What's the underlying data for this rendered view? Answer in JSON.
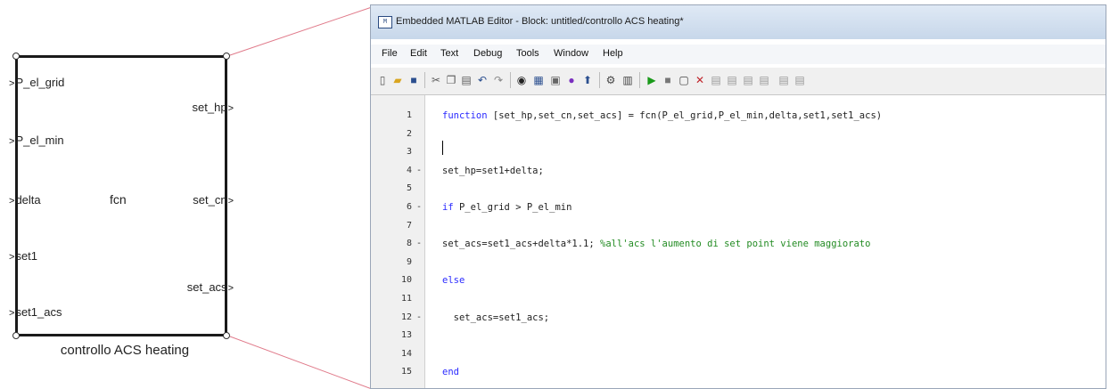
{
  "block": {
    "inputs": [
      "P_el_grid",
      "P_el_min",
      "delta",
      "set1",
      "set1_acs"
    ],
    "outputs": [
      "set_hp",
      "set_cn",
      "set_acs"
    ],
    "function_name": "fcn",
    "caption": "controllo ACS heating"
  },
  "editor": {
    "title": "Embedded MATLAB Editor - Block: untitled/controllo ACS heating*",
    "menu": [
      "File",
      "Edit",
      "Text",
      "Debug",
      "Tools",
      "Window",
      "Help"
    ],
    "toolbar_icons": [
      "new-file-icon",
      "open-folder-icon",
      "save-icon",
      "cut-icon",
      "copy-icon",
      "paste-icon",
      "undo-icon",
      "redo-icon",
      "find-icon",
      "explorer-icon",
      "print-icon",
      "simulink-icon",
      "go-to-diagram-icon",
      "build-icon",
      "data-manager-icon",
      "run-icon",
      "stop-icon",
      "set-breakpoint-icon",
      "clear-breakpoint-icon",
      "step-icon",
      "step-in-icon",
      "step-out-icon",
      "continue-icon",
      "exit-debug-icon"
    ],
    "code_lines": [
      {
        "num": "1",
        "mark": "",
        "parts": [
          {
            "t": "function",
            "k": "kw"
          },
          {
            "t": " [set_hp,set_cn,set_acs] = fcn(P_el_grid,P_el_min,delta,set1,set1_acs)",
            "k": ""
          }
        ]
      },
      {
        "num": "2",
        "mark": "",
        "parts": []
      },
      {
        "num": "3",
        "mark": "",
        "parts": []
      },
      {
        "num": "4",
        "mark": "-",
        "parts": [
          {
            "t": "set_hp=set1+delta;",
            "k": ""
          }
        ]
      },
      {
        "num": "5",
        "mark": "",
        "parts": []
      },
      {
        "num": "6",
        "mark": "-",
        "parts": [
          {
            "t": "if",
            "k": "kw"
          },
          {
            "t": " P_el_grid > P_el_min",
            "k": ""
          }
        ]
      },
      {
        "num": "7",
        "mark": "",
        "parts": []
      },
      {
        "num": "8",
        "mark": "-",
        "parts": [
          {
            "t": "set_acs=set1_acs+delta*1.1; ",
            "k": ""
          },
          {
            "t": "%all'acs l'aumento di set point viene maggiorato",
            "k": "cm"
          }
        ]
      },
      {
        "num": "9",
        "mark": "",
        "parts": []
      },
      {
        "num": "10",
        "mark": "",
        "parts": [
          {
            "t": "else",
            "k": "kw"
          }
        ]
      },
      {
        "num": "11",
        "mark": "",
        "parts": []
      },
      {
        "num": "12",
        "mark": "-",
        "parts": [
          {
            "t": "  set_acs=set1_acs;",
            "k": ""
          }
        ]
      },
      {
        "num": "13",
        "mark": "",
        "parts": []
      },
      {
        "num": "14",
        "mark": "",
        "parts": []
      },
      {
        "num": "15",
        "mark": "",
        "parts": [
          {
            "t": "end",
            "k": "kw"
          }
        ]
      }
    ]
  },
  "colors": {
    "connector": "#e07a8a",
    "keyword": "#2a2aff",
    "comment": "#228b22",
    "run": "#1a9a1a",
    "breakpoint": "#c0262c"
  }
}
